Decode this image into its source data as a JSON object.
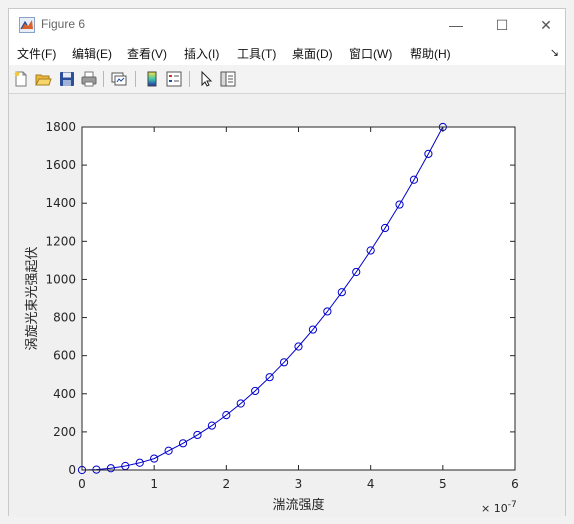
{
  "window": {
    "title": "Figure 6",
    "minimize": "—",
    "maximize": "☐",
    "close": "✕"
  },
  "menu": [
    {
      "label": "文件(F)"
    },
    {
      "label": "编辑(E)"
    },
    {
      "label": "查看(V)"
    },
    {
      "label": "插入(I)"
    },
    {
      "label": "工具(T)"
    },
    {
      "label": "桌面(D)"
    },
    {
      "label": "窗口(W)"
    },
    {
      "label": "帮助(H)"
    }
  ],
  "menu_overflow": "↘",
  "toolbar": {
    "icons": [
      "new-figure-icon",
      "open-file-icon",
      "save-icon",
      "print-icon",
      "link-plot-icon",
      "colorbar-icon",
      "legend-icon",
      "select-arrow-icon",
      "property-inspector-icon"
    ]
  },
  "chart_data": {
    "type": "line",
    "title": "",
    "xlabel": "湍流强度",
    "ylabel": "涡旋光束光强起伏",
    "x_exponent": "× 10",
    "x_exponent_power": "-7",
    "xlim": [
      0,
      6
    ],
    "ylim": [
      0,
      1800
    ],
    "xticks": [
      0,
      1,
      2,
      3,
      4,
      5,
      6
    ],
    "yticks": [
      0,
      200,
      400,
      600,
      800,
      1000,
      1200,
      1400,
      1600,
      1800
    ],
    "marker": "circle",
    "color": "#0000cc",
    "grid": false,
    "series": [
      {
        "x": [
          0,
          0.2,
          0.4,
          0.6,
          0.8,
          1.0,
          1.2,
          1.4,
          1.6,
          1.8,
          2.0,
          2.2,
          2.4,
          2.6,
          2.8,
          3.0,
          3.2,
          3.4,
          3.6,
          3.8,
          4.0,
          4.2,
          4.4,
          4.6,
          4.8,
          5.0
        ],
        "values": [
          0,
          2,
          9,
          21,
          38,
          60,
          101,
          140,
          184,
          233,
          288,
          349,
          415,
          487,
          565,
          648,
          737,
          832,
          933,
          1039,
          1152,
          1270,
          1393,
          1523,
          1659,
          1800
        ]
      }
    ]
  }
}
